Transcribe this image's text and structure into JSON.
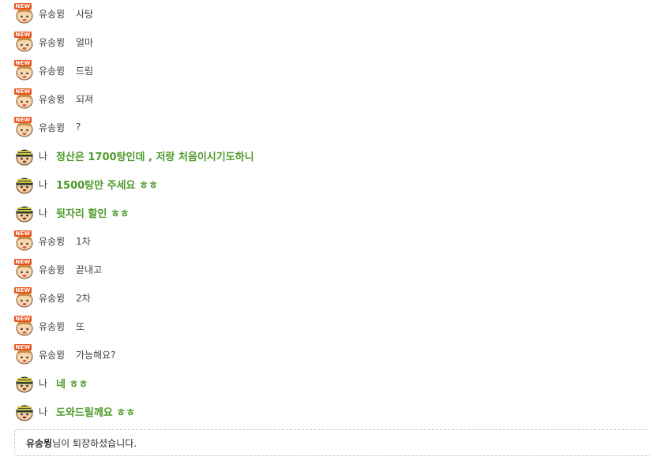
{
  "messages": [
    {
      "sender": "other",
      "name": "유송뮝",
      "text": "사탕"
    },
    {
      "sender": "other",
      "name": "유송뮝",
      "text": "얼마"
    },
    {
      "sender": "other",
      "name": "유송뮝",
      "text": "드림"
    },
    {
      "sender": "other",
      "name": "유송뮝",
      "text": "되져"
    },
    {
      "sender": "other",
      "name": "유송뮝",
      "text": "?"
    },
    {
      "sender": "me",
      "name": "나",
      "text": "정산은 1700탕인데 , 저랑 처음이시기도하니"
    },
    {
      "sender": "me",
      "name": "나",
      "text": "1500탕만 주세요 ㅎㅎ"
    },
    {
      "sender": "me",
      "name": "나",
      "text": "뒷자리 할인 ㅎㅎ"
    },
    {
      "sender": "other",
      "name": "유송뮝",
      "text": "1차"
    },
    {
      "sender": "other",
      "name": "유송뮝",
      "text": "끝내고"
    },
    {
      "sender": "other",
      "name": "유송뮝",
      "text": "2차"
    },
    {
      "sender": "other",
      "name": "유송뮝",
      "text": "또"
    },
    {
      "sender": "other",
      "name": "유송뮝",
      "text": "가능해요?"
    },
    {
      "sender": "me",
      "name": "나",
      "text": "네 ㅎㅎ"
    },
    {
      "sender": "me",
      "name": "나",
      "text": "도와드릴께요 ㅎㅎ"
    }
  ],
  "badges": {
    "new": "NEW"
  },
  "notice": {
    "name": "유송뮝",
    "suffix": "님이 퇴장하셨습니다."
  },
  "colors": {
    "me_text": "#4c9a2a",
    "other_text": "#444444",
    "badge": "#e8541c"
  }
}
